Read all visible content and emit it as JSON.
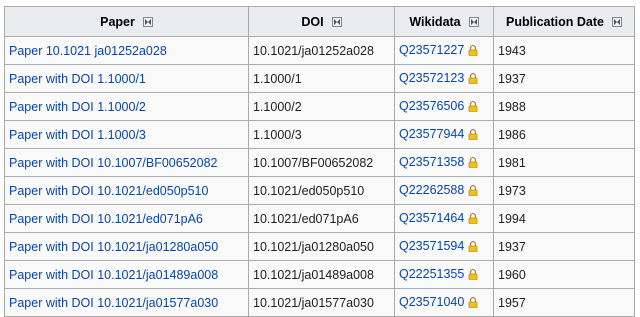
{
  "headers": [
    "Paper",
    "DOI",
    "Wikidata",
    "Publication Date"
  ],
  "rows": [
    {
      "paper": "Paper 10.1021 ja01252a028",
      "doi": "10.1021/ja01252a028",
      "qid": "Q23571227",
      "date": "1943"
    },
    {
      "paper": "Paper with DOI 1.1000/1",
      "doi": "1.1000/1",
      "qid": "Q23572123",
      "date": "1937"
    },
    {
      "paper": "Paper with DOI 1.1000/2",
      "doi": "1.1000/2",
      "qid": "Q23576506",
      "date": "1988"
    },
    {
      "paper": "Paper with DOI 1.1000/3",
      "doi": "1.1000/3",
      "qid": "Q23577944",
      "date": "1986"
    },
    {
      "paper": "Paper with DOI 10.1007/BF00652082",
      "doi": "10.1007/BF00652082",
      "qid": "Q23571358",
      "date": "1981"
    },
    {
      "paper": "Paper with DOI 10.1021/ed050p510",
      "doi": "10.1021/ed050p510",
      "qid": "Q22262588",
      "date": "1973"
    },
    {
      "paper": "Paper with DOI 10.1021/ed071pA6",
      "doi": "10.1021/ed071pA6",
      "qid": "Q23571464",
      "date": "1994"
    },
    {
      "paper": "Paper with DOI 10.1021/ja01280a050",
      "doi": "10.1021/ja01280a050",
      "qid": "Q23571594",
      "date": "1937"
    },
    {
      "paper": "Paper with DOI 10.1021/ja01489a008",
      "doi": "10.1021/ja01489a008",
      "qid": "Q22251355",
      "date": "1960"
    },
    {
      "paper": "Paper with DOI 10.1021/ja01577a030",
      "doi": "10.1021/ja01577a030",
      "qid": "Q23571040",
      "date": "1957"
    }
  ],
  "colors": {
    "link": "#0645ad",
    "header_bg": "#eaecf0",
    "cell_bg": "#f9f9f9",
    "border": "#aaaaaa",
    "lock": "#e8b820"
  },
  "icons": {
    "sort": "sort-toggle-icon",
    "lock": "padlock-icon"
  }
}
